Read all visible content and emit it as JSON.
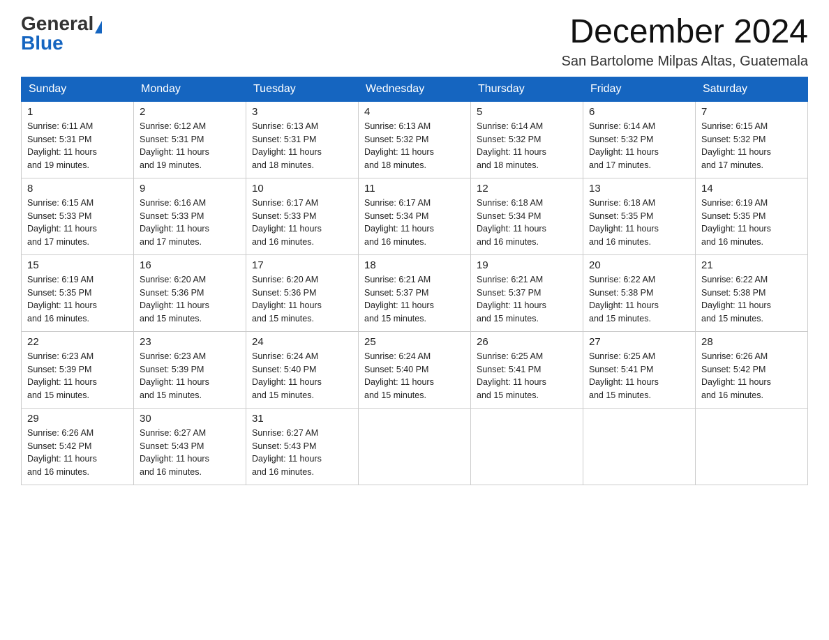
{
  "header": {
    "logo_general": "General",
    "logo_blue": "Blue",
    "month_title": "December 2024",
    "location": "San Bartolome Milpas Altas, Guatemala"
  },
  "days_of_week": [
    "Sunday",
    "Monday",
    "Tuesday",
    "Wednesday",
    "Thursday",
    "Friday",
    "Saturday"
  ],
  "weeks": [
    [
      {
        "day": "1",
        "sunrise": "6:11 AM",
        "sunset": "5:31 PM",
        "daylight": "11 hours and 19 minutes."
      },
      {
        "day": "2",
        "sunrise": "6:12 AM",
        "sunset": "5:31 PM",
        "daylight": "11 hours and 19 minutes."
      },
      {
        "day": "3",
        "sunrise": "6:13 AM",
        "sunset": "5:31 PM",
        "daylight": "11 hours and 18 minutes."
      },
      {
        "day": "4",
        "sunrise": "6:13 AM",
        "sunset": "5:32 PM",
        "daylight": "11 hours and 18 minutes."
      },
      {
        "day": "5",
        "sunrise": "6:14 AM",
        "sunset": "5:32 PM",
        "daylight": "11 hours and 18 minutes."
      },
      {
        "day": "6",
        "sunrise": "6:14 AM",
        "sunset": "5:32 PM",
        "daylight": "11 hours and 17 minutes."
      },
      {
        "day": "7",
        "sunrise": "6:15 AM",
        "sunset": "5:32 PM",
        "daylight": "11 hours and 17 minutes."
      }
    ],
    [
      {
        "day": "8",
        "sunrise": "6:15 AM",
        "sunset": "5:33 PM",
        "daylight": "11 hours and 17 minutes."
      },
      {
        "day": "9",
        "sunrise": "6:16 AM",
        "sunset": "5:33 PM",
        "daylight": "11 hours and 17 minutes."
      },
      {
        "day": "10",
        "sunrise": "6:17 AM",
        "sunset": "5:33 PM",
        "daylight": "11 hours and 16 minutes."
      },
      {
        "day": "11",
        "sunrise": "6:17 AM",
        "sunset": "5:34 PM",
        "daylight": "11 hours and 16 minutes."
      },
      {
        "day": "12",
        "sunrise": "6:18 AM",
        "sunset": "5:34 PM",
        "daylight": "11 hours and 16 minutes."
      },
      {
        "day": "13",
        "sunrise": "6:18 AM",
        "sunset": "5:35 PM",
        "daylight": "11 hours and 16 minutes."
      },
      {
        "day": "14",
        "sunrise": "6:19 AM",
        "sunset": "5:35 PM",
        "daylight": "11 hours and 16 minutes."
      }
    ],
    [
      {
        "day": "15",
        "sunrise": "6:19 AM",
        "sunset": "5:35 PM",
        "daylight": "11 hours and 16 minutes."
      },
      {
        "day": "16",
        "sunrise": "6:20 AM",
        "sunset": "5:36 PM",
        "daylight": "11 hours and 15 minutes."
      },
      {
        "day": "17",
        "sunrise": "6:20 AM",
        "sunset": "5:36 PM",
        "daylight": "11 hours and 15 minutes."
      },
      {
        "day": "18",
        "sunrise": "6:21 AM",
        "sunset": "5:37 PM",
        "daylight": "11 hours and 15 minutes."
      },
      {
        "day": "19",
        "sunrise": "6:21 AM",
        "sunset": "5:37 PM",
        "daylight": "11 hours and 15 minutes."
      },
      {
        "day": "20",
        "sunrise": "6:22 AM",
        "sunset": "5:38 PM",
        "daylight": "11 hours and 15 minutes."
      },
      {
        "day": "21",
        "sunrise": "6:22 AM",
        "sunset": "5:38 PM",
        "daylight": "11 hours and 15 minutes."
      }
    ],
    [
      {
        "day": "22",
        "sunrise": "6:23 AM",
        "sunset": "5:39 PM",
        "daylight": "11 hours and 15 minutes."
      },
      {
        "day": "23",
        "sunrise": "6:23 AM",
        "sunset": "5:39 PM",
        "daylight": "11 hours and 15 minutes."
      },
      {
        "day": "24",
        "sunrise": "6:24 AM",
        "sunset": "5:40 PM",
        "daylight": "11 hours and 15 minutes."
      },
      {
        "day": "25",
        "sunrise": "6:24 AM",
        "sunset": "5:40 PM",
        "daylight": "11 hours and 15 minutes."
      },
      {
        "day": "26",
        "sunrise": "6:25 AM",
        "sunset": "5:41 PM",
        "daylight": "11 hours and 15 minutes."
      },
      {
        "day": "27",
        "sunrise": "6:25 AM",
        "sunset": "5:41 PM",
        "daylight": "11 hours and 15 minutes."
      },
      {
        "day": "28",
        "sunrise": "6:26 AM",
        "sunset": "5:42 PM",
        "daylight": "11 hours and 16 minutes."
      }
    ],
    [
      {
        "day": "29",
        "sunrise": "6:26 AM",
        "sunset": "5:42 PM",
        "daylight": "11 hours and 16 minutes."
      },
      {
        "day": "30",
        "sunrise": "6:27 AM",
        "sunset": "5:43 PM",
        "daylight": "11 hours and 16 minutes."
      },
      {
        "day": "31",
        "sunrise": "6:27 AM",
        "sunset": "5:43 PM",
        "daylight": "11 hours and 16 minutes."
      },
      null,
      null,
      null,
      null
    ]
  ],
  "labels": {
    "sunrise": "Sunrise:",
    "sunset": "Sunset:",
    "daylight": "Daylight:"
  },
  "colors": {
    "header_bg": "#1565c0",
    "border": "#aaa"
  }
}
